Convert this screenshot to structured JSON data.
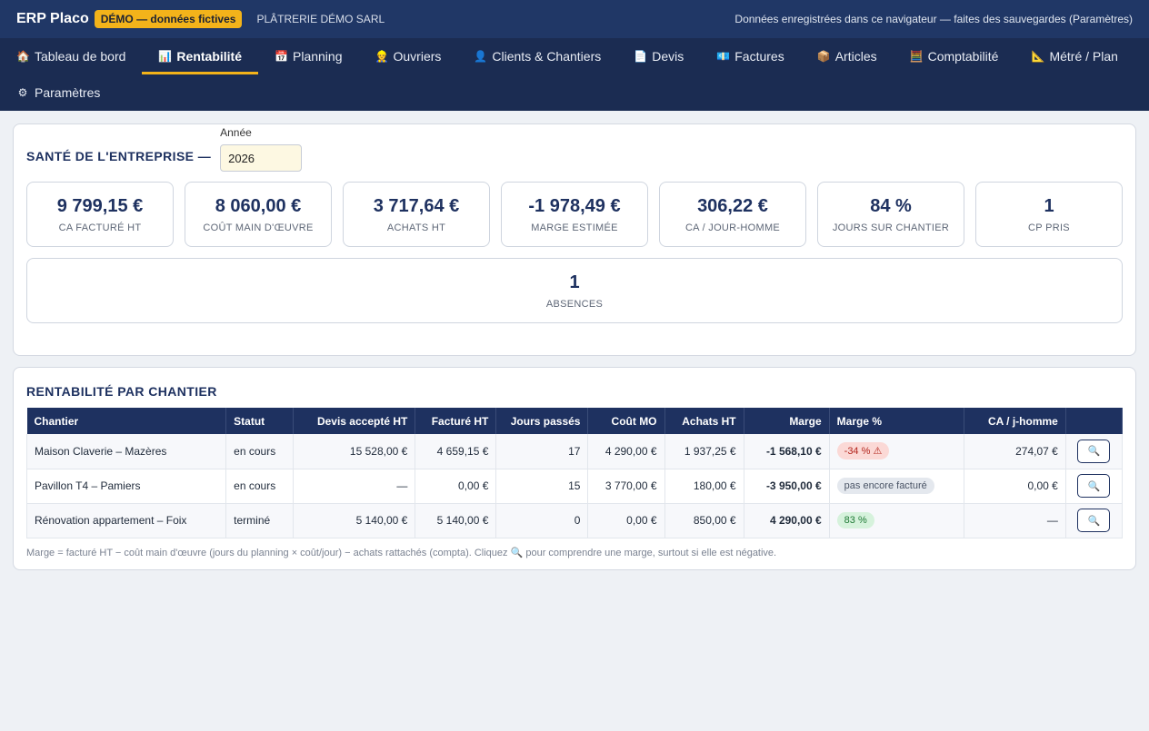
{
  "header": {
    "brand": "ERP Placo",
    "demo_badge": "DÉMO — données fictives",
    "company": "PLÂTRERIE DÉMO SARL",
    "storage_note": "Données enregistrées dans ce navigateur — faites des sauvegardes (Paramètres)"
  },
  "nav": {
    "row1": [
      {
        "icon": "🏠",
        "label": "Tableau de bord"
      },
      {
        "icon": "📊",
        "label": "Rentabilité"
      },
      {
        "icon": "📅",
        "label": "Planning"
      },
      {
        "icon": "👷",
        "label": "Ouvriers"
      },
      {
        "icon": "👤",
        "label": "Clients & Chantiers"
      },
      {
        "icon": "📄",
        "label": "Devis"
      },
      {
        "icon": "💶",
        "label": "Factures"
      },
      {
        "icon": "📦",
        "label": "Articles"
      },
      {
        "icon": "🧮",
        "label": "Comptabilité"
      },
      {
        "icon": "📐",
        "label": "Métré / Plan"
      }
    ],
    "row2": [
      {
        "icon": "⚙",
        "label": "Paramètres"
      }
    ],
    "active": "Rentabilité"
  },
  "health": {
    "title": "SANTÉ DE L'ENTREPRISE —",
    "year_label": "Année",
    "year_value": "2026",
    "kpis": [
      {
        "value": "9 799,15 €",
        "label": "CA FACTURÉ HT"
      },
      {
        "value": "8 060,00 €",
        "label": "COÛT MAIN D'ŒUVRE"
      },
      {
        "value": "3 717,64 €",
        "label": "ACHATS HT"
      },
      {
        "value": "-1 978,49 €",
        "label": "MARGE ESTIMÉE"
      },
      {
        "value": "306,22 €",
        "label": "CA / JOUR-HOMME"
      },
      {
        "value": "84 %",
        "label": "JOURS SUR CHANTIER"
      },
      {
        "value": "1",
        "label": "CP PRIS"
      }
    ],
    "absences": {
      "value": "1",
      "label": "ABSENCES"
    }
  },
  "profit": {
    "title": "RENTABILITÉ PAR CHANTIER",
    "columns": [
      "Chantier",
      "Statut",
      "Devis accepté HT",
      "Facturé HT",
      "Jours passés",
      "Coût MO",
      "Achats HT",
      "Marge",
      "Marge %",
      "CA / j-homme",
      ""
    ],
    "rows": [
      {
        "chantier": "Maison Claverie – Mazères",
        "statut": "en cours",
        "devis": "15 528,00 €",
        "facture": "4 659,15 €",
        "jours": "17",
        "cout_mo": "4 290,00 €",
        "achats": "1 937,25 €",
        "marge": "-1 568,10 €",
        "marge_pct": "-34 % ⚠",
        "marge_pct_kind": "neg",
        "ca_jh": "274,07 €"
      },
      {
        "chantier": "Pavillon T4 – Pamiers",
        "statut": "en cours",
        "devis": "—",
        "facture": "0,00 €",
        "jours": "15",
        "cout_mo": "3 770,00 €",
        "achats": "180,00 €",
        "marge": "-3 950,00 €",
        "marge_pct": "pas encore facturé",
        "marge_pct_kind": "grey",
        "ca_jh": "0,00 €"
      },
      {
        "chantier": "Rénovation appartement – Foix",
        "statut": "terminé",
        "devis": "5 140,00 €",
        "facture": "5 140,00 €",
        "jours": "0",
        "cout_mo": "0,00 €",
        "achats": "850,00 €",
        "marge": "4 290,00 €",
        "marge_pct": "83 %",
        "marge_pct_kind": "pos",
        "ca_jh": "—"
      }
    ],
    "explain_icon": "🔍",
    "footnote": "Marge = facturé HT − coût main d'œuvre (jours du planning × coût/jour) − achats rattachés (compta). Cliquez 🔍 pour comprendre une marge, surtout si elle est négative."
  }
}
